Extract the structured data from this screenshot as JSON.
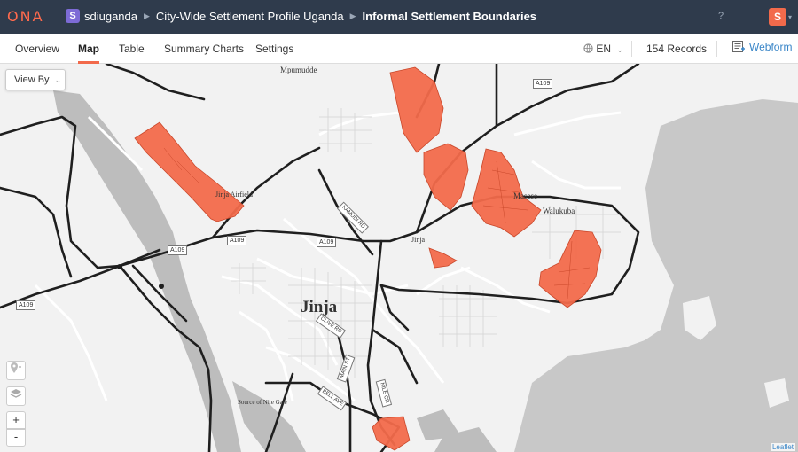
{
  "app": {
    "logo": "ONA"
  },
  "breadcrumb": {
    "org_badge": "S",
    "org": "sdiuganda",
    "project": "City-Wide Settlement Profile Uganda",
    "form": "Informal Settlement Boundaries"
  },
  "topbar": {
    "help": "?",
    "avatar_initial": "S"
  },
  "tabs": [
    "Overview",
    "Map",
    "Table",
    "Summary Charts",
    "Settings"
  ],
  "active_tab": "Map",
  "language": "EN",
  "records": "154 Records",
  "webform_label": "Webform",
  "map": {
    "view_by": "View By",
    "zoom_in": "+",
    "zoom_out": "-",
    "attribution": "Leaflet",
    "place_labels": {
      "mpumudde": "Mpumudde",
      "jinja_airfield": "Jinja Airfield",
      "jinja_small": "Jinja",
      "jinja_city": "Jinja",
      "masese": "Masese",
      "walukuba": "Walukuba",
      "source_of_nile": "Source of Nile Gate"
    },
    "road_labels": {
      "a109_ne": "A109",
      "a109_mid": "A109",
      "a109_center": "A109",
      "a109_west": "A109",
      "a109_sw": "A109"
    },
    "street_labels": [
      "KAMUDI RD",
      "CLIVE RD",
      "MAIN ST",
      "BELL AVE",
      "NILE CR"
    ],
    "settlement_color": "#f26a4b",
    "water_color": "#c8c8c8"
  }
}
